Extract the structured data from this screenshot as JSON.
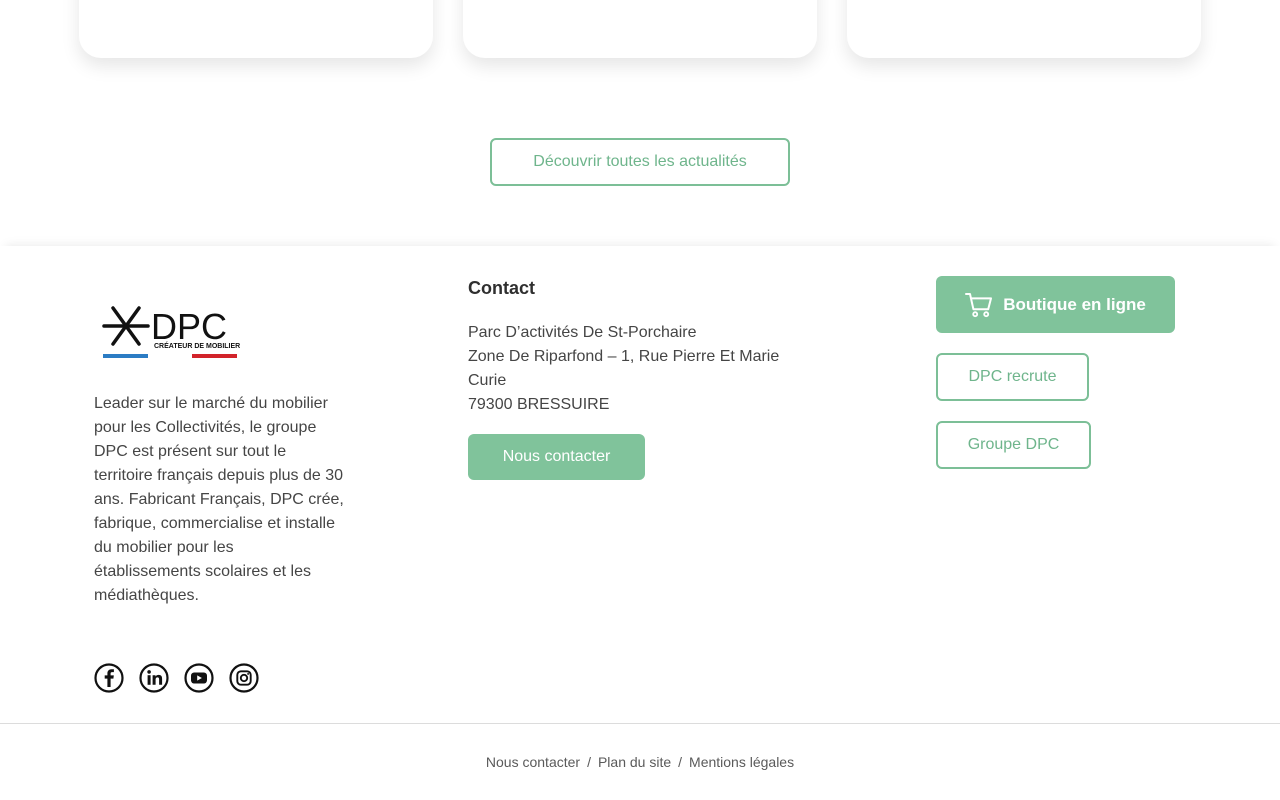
{
  "news": {
    "button_label": "Découvrir toutes les actualités"
  },
  "brand": {
    "logo_text": "DPC",
    "logo_tagline": "CRÉATEUR DE MOBILIER",
    "about_text": "Leader sur le marché du mobilier pour les Collectivités, le groupe DPC est présent sur tout le territoire français depuis plus de 30 ans. Fabricant Français, DPC crée, fabrique, commercialise et installe du mobilier pour les établissements scolaires et les médiathèques."
  },
  "social": [
    {
      "icon": "facebook-icon"
    },
    {
      "icon": "linkedin-icon"
    },
    {
      "icon": "youtube-icon"
    },
    {
      "icon": "instagram-icon"
    }
  ],
  "contact": {
    "title": "Contact",
    "address_line1": "Parc D’activités De St-Porchaire",
    "address_line2": "Zone De Riparfond – 1, Rue Pierre Et Marie Curie",
    "address_line3": "79300 BRESSUIRE",
    "button_label": "Nous contacter"
  },
  "links": {
    "shop_label": "Boutique en ligne",
    "recruit_label": "DPC recrute",
    "group_label": "Groupe DPC"
  },
  "bottom_nav": {
    "items": [
      "Nous contacter",
      "Plan du site",
      "Mentions légales"
    ],
    "separator": "/"
  },
  "colors": {
    "accent": "#80c39b",
    "accent_text": "#6fb58c",
    "logo_blue": "#2b7cc4",
    "logo_red": "#d2232a"
  }
}
